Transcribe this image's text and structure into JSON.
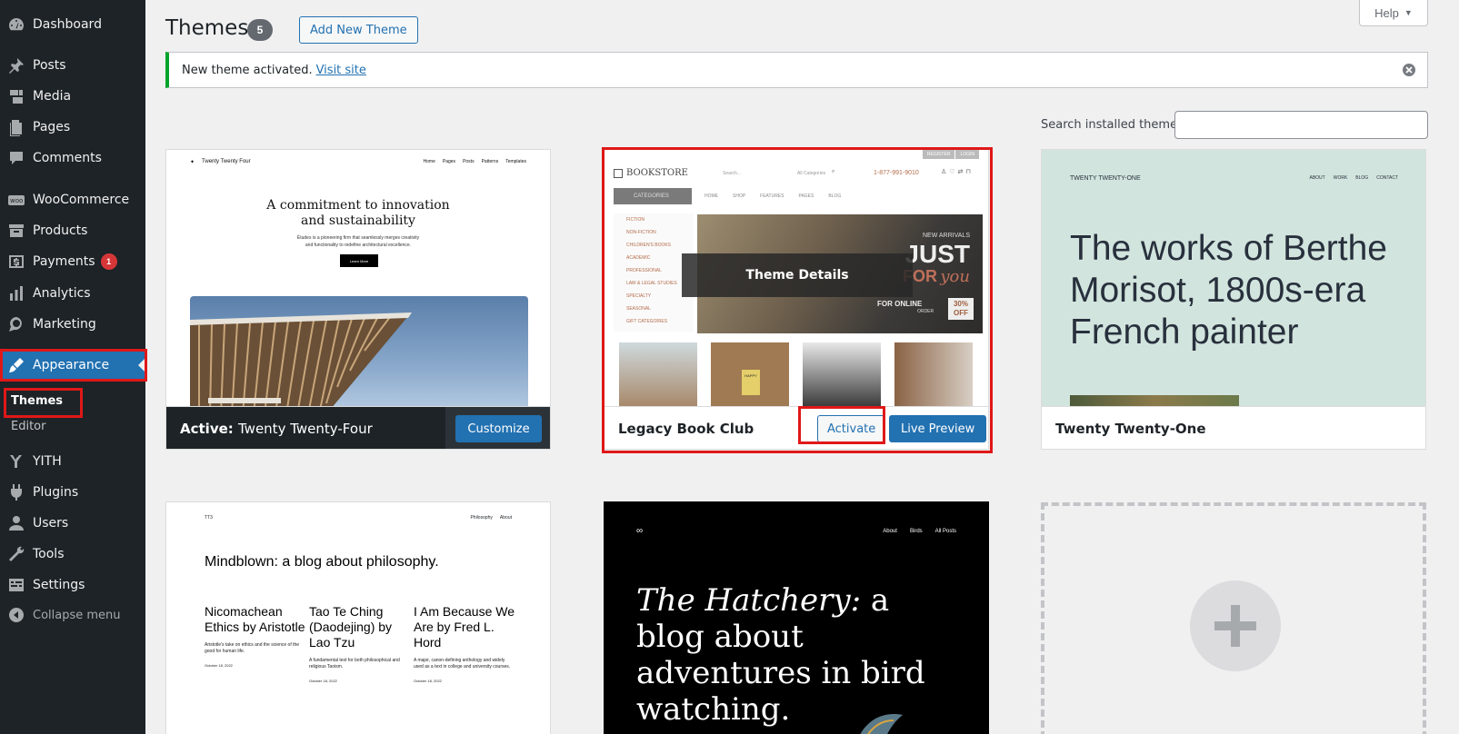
{
  "sidebar": {
    "items": [
      {
        "label": "Dashboard",
        "icon": "dashboard-icon"
      },
      {
        "label": "Posts",
        "icon": "pin-icon"
      },
      {
        "label": "Media",
        "icon": "media-icon"
      },
      {
        "label": "Pages",
        "icon": "pages-icon"
      },
      {
        "label": "Comments",
        "icon": "comment-icon"
      },
      {
        "label": "WooCommerce",
        "icon": "woo-icon"
      },
      {
        "label": "Products",
        "icon": "archive-icon"
      },
      {
        "label": "Payments",
        "icon": "dollar-icon",
        "badge": "1"
      },
      {
        "label": "Analytics",
        "icon": "chart-icon"
      },
      {
        "label": "Marketing",
        "icon": "megaphone-icon"
      },
      {
        "label": "Appearance",
        "icon": "brush-icon"
      },
      {
        "label": "YITH",
        "icon": "yith-icon"
      },
      {
        "label": "Plugins",
        "icon": "plug-icon"
      },
      {
        "label": "Users",
        "icon": "user-icon"
      },
      {
        "label": "Tools",
        "icon": "wrench-icon"
      },
      {
        "label": "Settings",
        "icon": "settings-icon"
      }
    ],
    "submenu": {
      "themes": "Themes",
      "editor": "Editor"
    },
    "collapse": "Collapse menu"
  },
  "header": {
    "title": "Themes",
    "count": "5",
    "add_new": "Add New Theme",
    "help": "Help"
  },
  "notice": {
    "text": "New theme activated.",
    "link": "Visit site"
  },
  "search": {
    "label": "Search installed themes",
    "value": ""
  },
  "themes": {
    "tt4": {
      "active_prefix": "Active:",
      "name": "Twenty Twenty-Four",
      "customize": "Customize",
      "shot_brand": "Twenty Twenty Four",
      "shot_nav": [
        "Home",
        "Pages",
        "Posts",
        "Patterns",
        "Templates"
      ],
      "shot_headline_1": "A commitment to innovation",
      "shot_headline_2": "and sustainability",
      "shot_sub_1": "Études is a pioneering firm that seamlessly merges creativity",
      "shot_sub_2": "and functionality to redefine architectural excellence.",
      "shot_button": "Learn More"
    },
    "bookclub": {
      "name": "Legacy Book Club",
      "details": "Theme Details",
      "activate": "Activate",
      "live_preview": "Live Preview",
      "shot_logo": "BOOKSTORE",
      "shot_search": "Search...",
      "shot_categories_select": "All Categories",
      "shot_phone": "1-877-991-9010",
      "shot_register": "REGISTER",
      "shot_login": "LOGIN",
      "shot_categories": "CATEGORIES",
      "shot_nav": [
        "HOME",
        "SHOP",
        "FEATURES",
        "PAGES",
        "BLOG"
      ],
      "shot_side": [
        "FICTION",
        "NON-FICTION",
        "CHILDREN'S BOOKS",
        "ACADEMIC",
        "PROFESSIONAL",
        "LAW & LEGAL STUDIES",
        "SPECIALTY",
        "SEASONAL",
        "GIFT CATEGORIES"
      ],
      "shot_hero_small": "NEW ARRIVALS",
      "shot_hero_big": "JUST",
      "shot_hero_for": "FOR",
      "shot_hero_you": "you",
      "shot_hero_online": "FOR ONLINE",
      "shot_hero_order": "ORDER",
      "shot_hero_pct": "30%",
      "shot_hero_off": "OFF",
      "shot_book_label": "HAPPY"
    },
    "tt1": {
      "name": "Twenty Twenty-One",
      "shot_brand": "TWENTY TWENTY-ONE",
      "shot_nav": [
        "ABOUT",
        "WORK",
        "BLOG",
        "CONTACT"
      ],
      "shot_headline": "The works of Berthe Morisot, 1800s-era French painter"
    },
    "tt3": {
      "shot_brand": "TT3",
      "shot_nav": [
        "Philosophy",
        "About"
      ],
      "shot_headline": "Mindblown: a blog about philosophy.",
      "shot_posts": [
        {
          "title": "Nicomachean Ethics by Aristotle",
          "excerpt": "Aristotle's take on ethics and the science of the good for human life.",
          "date": "October 18, 2022"
        },
        {
          "title": "Tao Te Ching (Daodejing) by Lao Tzu",
          "excerpt": "A fundamental text for both philosophical and religious Taoism.",
          "date": "October 18, 2022"
        },
        {
          "title": "I Am Because We Are by Fred L. Hord",
          "excerpt": "A major, canon-defining anthology and widely used as a text in college and university courses.",
          "date": "October 18, 2022"
        }
      ]
    },
    "hatchery": {
      "shot_nav": [
        "About",
        "Birds",
        "All Posts"
      ],
      "shot_headline_em": "The Hatchery:",
      "shot_headline_rest": " a blog about adventures in bird watching."
    }
  },
  "colors": {
    "admin_bg": "#1d2327",
    "accent": "#2271b1",
    "notice_border": "#00a32a",
    "badge": "#d63638",
    "highlight": "#e01818"
  }
}
